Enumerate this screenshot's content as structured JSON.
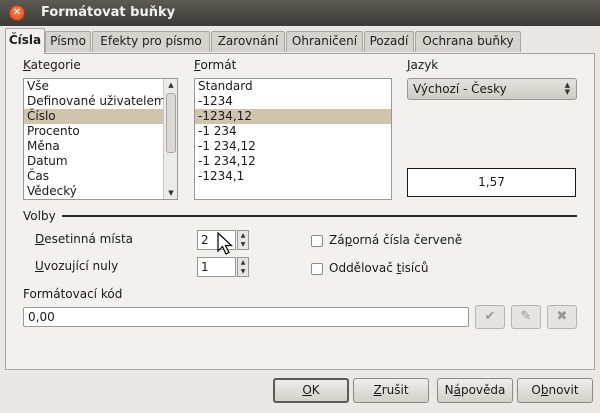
{
  "window": {
    "title": "Formátovat buňky",
    "close_glyph": "✕"
  },
  "tabs": [
    {
      "label": "Čísla",
      "active": true
    },
    {
      "label": "Písmo"
    },
    {
      "label": "Efekty pro písmo"
    },
    {
      "label": "Zarovnání"
    },
    {
      "label": "Ohraničení"
    },
    {
      "label": "Pozadí"
    },
    {
      "label": "Ochrana buňky"
    }
  ],
  "category": {
    "label_accel": "K",
    "label_rest": "ategorie",
    "items": [
      "Vše",
      "Definované uživatelem",
      "Číslo",
      "Procento",
      "Měna",
      "Datum",
      "Čas",
      "Vědecký"
    ],
    "selected": "Číslo"
  },
  "format": {
    "label_accel": "F",
    "label_rest": "ormát",
    "items": [
      "Standard",
      "-1234",
      "-1234,12",
      "-1 234",
      "-1 234,12",
      "-1 234,12",
      "-1234,1"
    ],
    "selected": "-1234,12"
  },
  "language": {
    "label_accel": "J",
    "label_rest": "azyk",
    "value": "Výchozí - Česky"
  },
  "preview": {
    "value": "1,57"
  },
  "options": {
    "title": "Volby",
    "decimal_places": {
      "label_accel": "D",
      "label_rest": "esetinná místa",
      "value": "2"
    },
    "leading_zeros": {
      "label_accel": "U",
      "label_rest": "vozující nuly",
      "value": "1"
    },
    "negative_red": {
      "label_pre": "Zá",
      "label_accel": "p",
      "label_rest": "orná čísla červeně",
      "checked": false
    },
    "thousands_sep": {
      "label_pre": "Oddělovač ",
      "label_accel": "t",
      "label_rest": "isíců",
      "checked": false
    }
  },
  "format_code": {
    "label": "Formátovací kód",
    "value": "0,00"
  },
  "buttons": {
    "ok": {
      "accel": "O",
      "rest": "K"
    },
    "cancel": {
      "accel": "Z",
      "rest": "rušit"
    },
    "help": {
      "pre": "N",
      "accel": "á",
      "rest": "pověda"
    },
    "reset": {
      "pre": "O",
      "accel": "b",
      "rest": "novit"
    }
  }
}
